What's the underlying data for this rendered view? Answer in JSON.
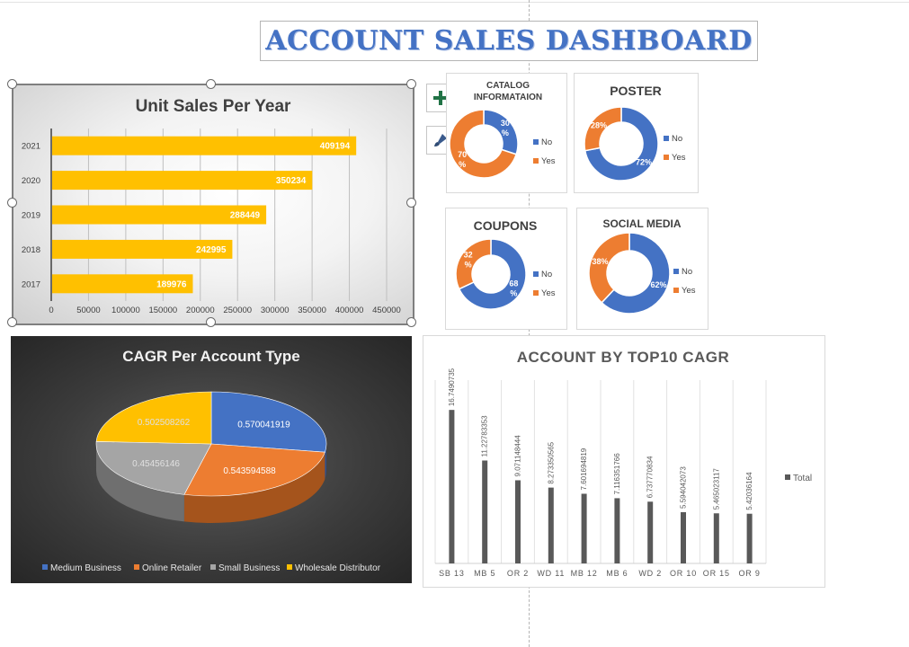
{
  "dashboard": {
    "title": "ACCOUNT SALES DASHBOARD"
  },
  "chart_tools": {
    "add_icon": "plus-icon",
    "style_icon": "brush-icon"
  },
  "colors": {
    "accent_blue": "#4472c4",
    "orange": "#ed7d31",
    "gray": "#a5a5a5",
    "gold": "#ffc000",
    "bar_yellow": "#ffc000",
    "column_gray": "#595959"
  },
  "chart_data": [
    {
      "id": "unit_sales",
      "type": "bar",
      "title": "Unit Sales Per Year",
      "categories": [
        "2021",
        "2020",
        "2019",
        "2018",
        "2017"
      ],
      "values": [
        409194,
        350234,
        288449,
        242995,
        189976
      ],
      "xlim": [
        0,
        450000
      ],
      "xticks": [
        "0",
        "50000",
        "100000",
        "150000",
        "200000",
        "250000",
        "300000",
        "350000",
        "400000",
        "450000"
      ],
      "data_labels": [
        "409194",
        "350234",
        "288449",
        "242995",
        "189976"
      ],
      "grid": true
    },
    {
      "id": "catalog",
      "type": "pie",
      "title": "CATALOG INFORMATAION",
      "labels": [
        "No",
        "Yes"
      ],
      "values": [
        30,
        70
      ],
      "data_labels": [
        "30 %",
        "70 %"
      ],
      "legend": "right"
    },
    {
      "id": "poster",
      "type": "pie",
      "title": "POSTER",
      "labels": [
        "No",
        "Yes"
      ],
      "values": [
        72,
        28
      ],
      "data_labels": [
        "72%",
        "28%"
      ],
      "legend": "right"
    },
    {
      "id": "coupons",
      "type": "pie",
      "title": "COUPONS",
      "labels": [
        "No",
        "Yes"
      ],
      "values": [
        68,
        32
      ],
      "data_labels": [
        "68 %",
        "32 %"
      ],
      "legend": "right"
    },
    {
      "id": "social_media",
      "type": "pie",
      "title": "SOCIAL MEDIA",
      "labels": [
        "No",
        "Yes"
      ],
      "values": [
        62,
        38
      ],
      "data_labels": [
        "62%",
        "38%"
      ],
      "legend": "right"
    },
    {
      "id": "cagr_per_account",
      "type": "pie",
      "title": "CAGR Per Account Type",
      "labels": [
        "Medium Business",
        "Online Retailer",
        "Small Business",
        "Wholesale Distributor"
      ],
      "values": [
        0.570041919,
        0.543594588,
        0.45456146,
        0.502508262
      ],
      "data_labels": [
        "0.570041919",
        "0.543594588",
        "0.45456146",
        "0.502508262"
      ],
      "legend": "bottom"
    },
    {
      "id": "top10_cagr",
      "type": "bar",
      "title": "ACCOUNT BY TOP10 CAGR",
      "categories": [
        "SB 13",
        "MB 5",
        "OR 2",
        "WD 11",
        "MB 12",
        "MB 6",
        "WD 2",
        "OR 10",
        "OR 15",
        "OR 9"
      ],
      "series": [
        {
          "name": "Total",
          "values": [
            16.7490735,
            11.22783353,
            9.071148444,
            8.273350565,
            7.601694819,
            7.116351766,
            6.737770834,
            5.594042073,
            5.465023117,
            5.42036164
          ]
        }
      ],
      "data_labels": [
        "16.7490735",
        "11.22783353",
        "9.071148444",
        "8.273350565",
        "7.601694819",
        "7.116351766",
        "6.737770834",
        "5.594042073",
        "5.465023117",
        "5.42036164"
      ],
      "legend": "right"
    }
  ]
}
